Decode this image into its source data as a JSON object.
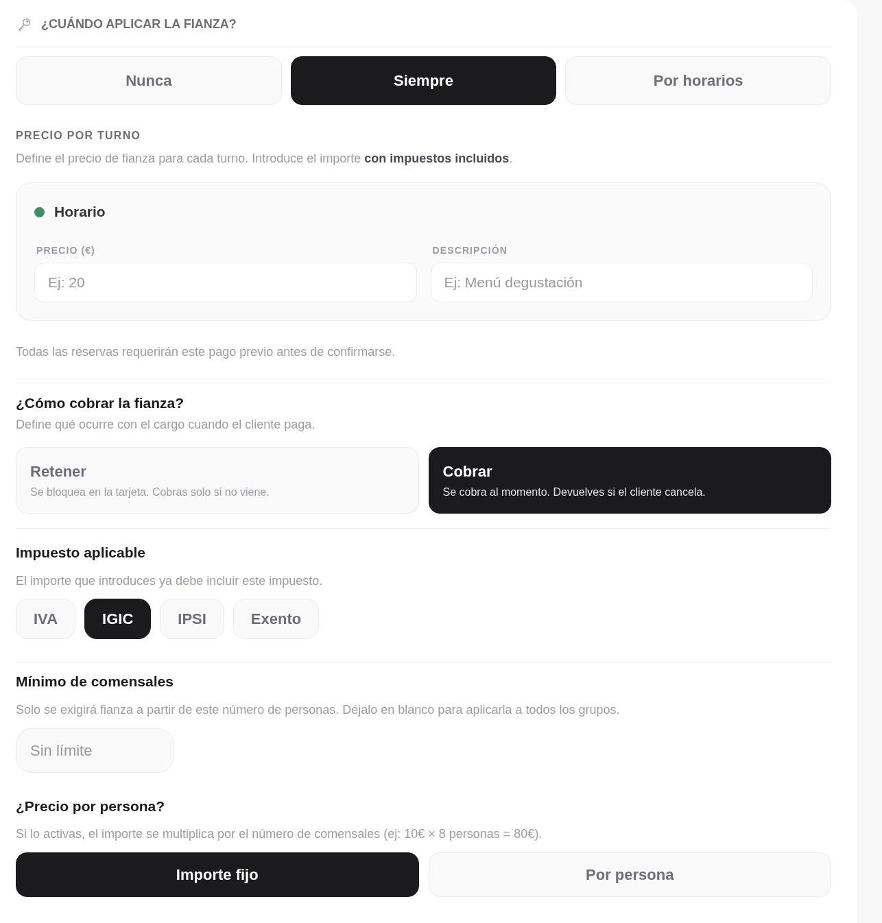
{
  "when_section": {
    "title": "¿CUÁNDO APLICAR LA FIANZA?",
    "options": [
      {
        "label": "Nunca",
        "selected": false
      },
      {
        "label": "Siempre",
        "selected": true
      },
      {
        "label": "Por horarios",
        "selected": false
      }
    ]
  },
  "price_per_shift": {
    "title": "PRECIO POR TURNO",
    "description": "Define el precio de fianza para cada turno. Introduce el importe **con impuestos incluidos**.",
    "shifts": [
      {
        "name": "Horario",
        "color": "#3d8f64",
        "fields": [
          {
            "label": "PRECIO (€)",
            "placeholder": "Ej: 20"
          },
          {
            "label": "DESCRIPCIÓN",
            "placeholder": "Ej: Menú degustación"
          }
        ]
      }
    ],
    "note": "Todas las reservas requerirán este pago previo antes de confirmarse."
  },
  "charge_method": {
    "title": "¿Cómo cobrar la fianza?",
    "description": "Define qué ocurre con el cargo cuando el cliente paga.",
    "options": [
      {
        "title": "Retener",
        "description": "Se bloquea en la tarjeta. Cobras solo si no viene.",
        "selected": false
      },
      {
        "title": "Cobrar",
        "description": "Se cobra al momento. Devuelves si el cliente cancela.",
        "selected": true
      }
    ]
  },
  "tax": {
    "title": "Impuesto aplicable",
    "description": "El importe que introduces ya debe incluir este impuesto.",
    "options": [
      {
        "label": "IVA",
        "selected": false
      },
      {
        "label": "IGIC",
        "selected": true
      },
      {
        "label": "IPSI",
        "selected": false
      },
      {
        "label": "Exento",
        "selected": false
      }
    ]
  },
  "min_diners": {
    "title": "Mínimo de comensales",
    "description": "Solo se exigirá fianza a partir de este número de personas. Déjalo en blanco para aplicarla a todos los grupos.",
    "field": {
      "placeholder": "Sin límite"
    }
  },
  "per_person": {
    "title": "¿Precio por persona?",
    "description": "Si lo activas, el importe se multiplica por el número de comensales (ej: 10€ × 8 personas = 80€).",
    "options": [
      {
        "label": "Importe fijo",
        "selected": true
      },
      {
        "label": "Por persona",
        "selected": false
      }
    ]
  }
}
